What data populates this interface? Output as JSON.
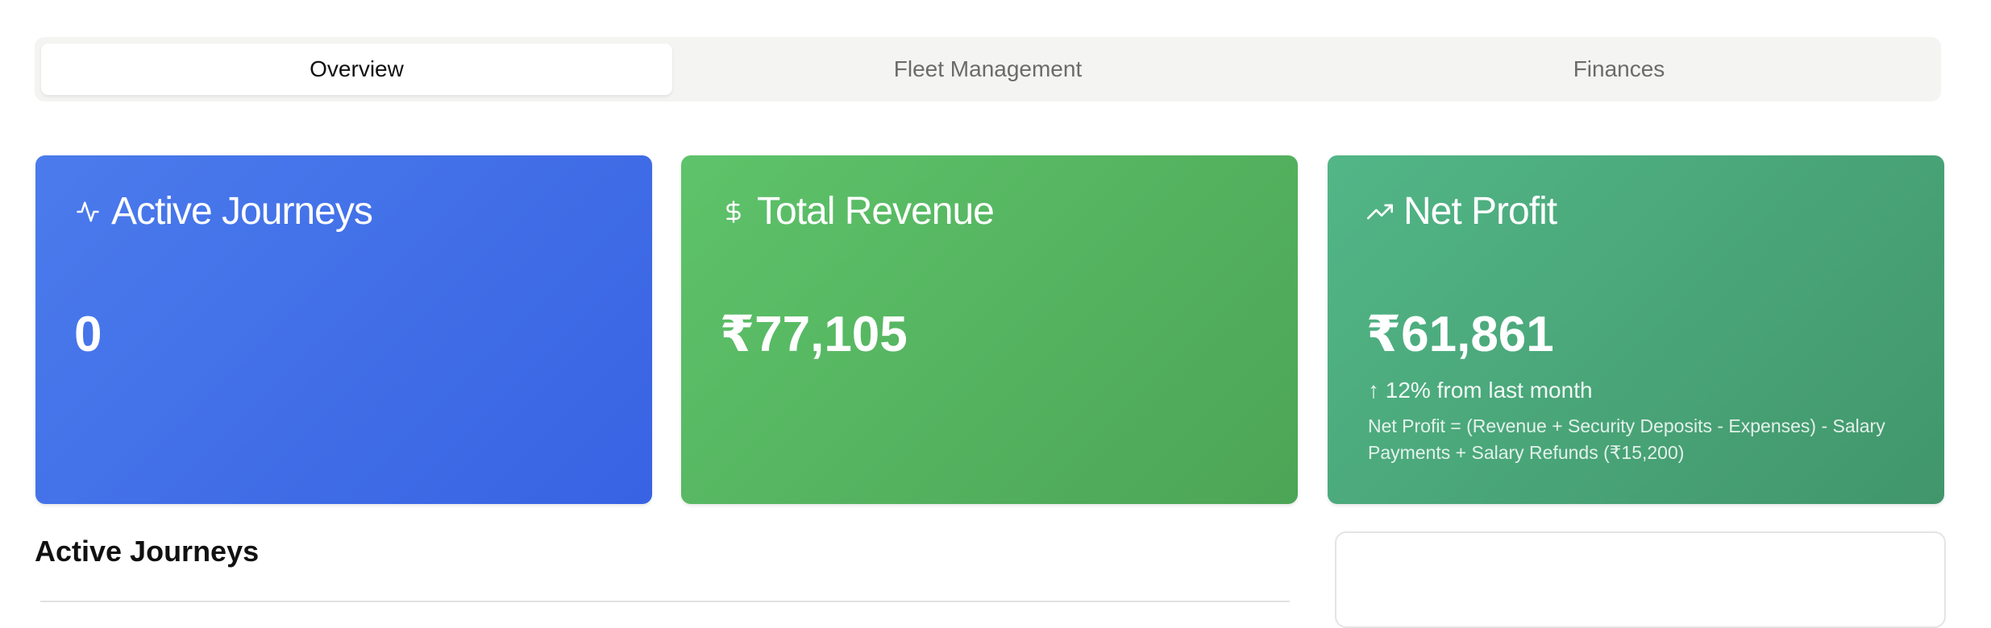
{
  "tabs": [
    {
      "label": "Overview",
      "active": true
    },
    {
      "label": "Fleet Management",
      "active": false
    },
    {
      "label": "Finances",
      "active": false
    }
  ],
  "cards": {
    "active_journeys": {
      "title": "Active Journeys",
      "value": "0",
      "icon": "activity-icon",
      "color": "#3f6fe8"
    },
    "total_revenue": {
      "title": "Total Revenue",
      "value": "₹77,105",
      "icon": "dollar-icon",
      "color": "#56b460"
    },
    "net_profit": {
      "title": "Net Profit",
      "value": "₹61,861",
      "change": "↑ 12% from last month",
      "note": "Net Profit = (Revenue + Security Deposits - Expenses) - Salary Payments + Salary Refunds (₹15,200)",
      "icon": "trending-up-icon",
      "color": "#4aa67a"
    }
  },
  "section": {
    "title": "Active Journeys"
  }
}
